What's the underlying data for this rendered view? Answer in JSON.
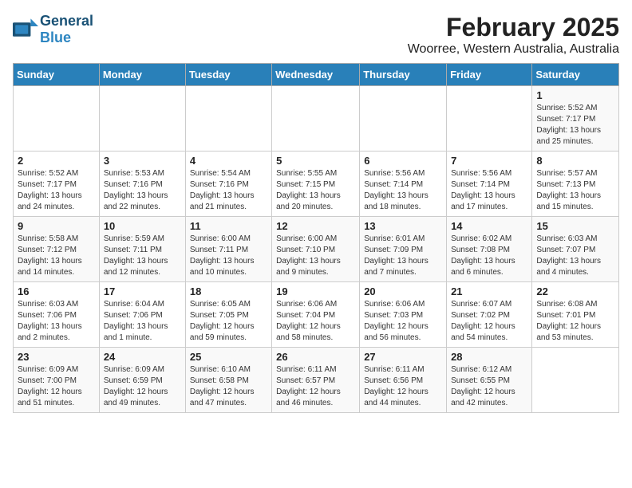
{
  "header": {
    "logo_general": "General",
    "logo_blue": "Blue",
    "title": "February 2025",
    "subtitle": "Woorree, Western Australia, Australia"
  },
  "days_of_week": [
    "Sunday",
    "Monday",
    "Tuesday",
    "Wednesday",
    "Thursday",
    "Friday",
    "Saturday"
  ],
  "weeks": [
    [
      null,
      null,
      null,
      null,
      null,
      null,
      {
        "day": 1,
        "sunrise": "5:52 AM",
        "sunset": "7:17 PM",
        "daylight": "13 hours and 25 minutes."
      }
    ],
    [
      {
        "day": 2,
        "sunrise": "5:52 AM",
        "sunset": "7:17 PM",
        "daylight": "13 hours and 24 minutes."
      },
      {
        "day": 3,
        "sunrise": "5:53 AM",
        "sunset": "7:16 PM",
        "daylight": "13 hours and 22 minutes."
      },
      {
        "day": 4,
        "sunrise": "5:54 AM",
        "sunset": "7:16 PM",
        "daylight": "13 hours and 21 minutes."
      },
      {
        "day": 5,
        "sunrise": "5:55 AM",
        "sunset": "7:15 PM",
        "daylight": "13 hours and 20 minutes."
      },
      {
        "day": 6,
        "sunrise": "5:56 AM",
        "sunset": "7:14 PM",
        "daylight": "13 hours and 18 minutes."
      },
      {
        "day": 7,
        "sunrise": "5:56 AM",
        "sunset": "7:14 PM",
        "daylight": "13 hours and 17 minutes."
      },
      {
        "day": 8,
        "sunrise": "5:57 AM",
        "sunset": "7:13 PM",
        "daylight": "13 hours and 15 minutes."
      }
    ],
    [
      {
        "day": 9,
        "sunrise": "5:58 AM",
        "sunset": "7:12 PM",
        "daylight": "13 hours and 14 minutes."
      },
      {
        "day": 10,
        "sunrise": "5:59 AM",
        "sunset": "7:11 PM",
        "daylight": "13 hours and 12 minutes."
      },
      {
        "day": 11,
        "sunrise": "6:00 AM",
        "sunset": "7:11 PM",
        "daylight": "13 hours and 10 minutes."
      },
      {
        "day": 12,
        "sunrise": "6:00 AM",
        "sunset": "7:10 PM",
        "daylight": "13 hours and 9 minutes."
      },
      {
        "day": 13,
        "sunrise": "6:01 AM",
        "sunset": "7:09 PM",
        "daylight": "13 hours and 7 minutes."
      },
      {
        "day": 14,
        "sunrise": "6:02 AM",
        "sunset": "7:08 PM",
        "daylight": "13 hours and 6 minutes."
      },
      {
        "day": 15,
        "sunrise": "6:03 AM",
        "sunset": "7:07 PM",
        "daylight": "13 hours and 4 minutes."
      }
    ],
    [
      {
        "day": 16,
        "sunrise": "6:03 AM",
        "sunset": "7:06 PM",
        "daylight": "13 hours and 2 minutes."
      },
      {
        "day": 17,
        "sunrise": "6:04 AM",
        "sunset": "7:06 PM",
        "daylight": "13 hours and 1 minute."
      },
      {
        "day": 18,
        "sunrise": "6:05 AM",
        "sunset": "7:05 PM",
        "daylight": "12 hours and 59 minutes."
      },
      {
        "day": 19,
        "sunrise": "6:06 AM",
        "sunset": "7:04 PM",
        "daylight": "12 hours and 58 minutes."
      },
      {
        "day": 20,
        "sunrise": "6:06 AM",
        "sunset": "7:03 PM",
        "daylight": "12 hours and 56 minutes."
      },
      {
        "day": 21,
        "sunrise": "6:07 AM",
        "sunset": "7:02 PM",
        "daylight": "12 hours and 54 minutes."
      },
      {
        "day": 22,
        "sunrise": "6:08 AM",
        "sunset": "7:01 PM",
        "daylight": "12 hours and 53 minutes."
      }
    ],
    [
      {
        "day": 23,
        "sunrise": "6:09 AM",
        "sunset": "7:00 PM",
        "daylight": "12 hours and 51 minutes."
      },
      {
        "day": 24,
        "sunrise": "6:09 AM",
        "sunset": "6:59 PM",
        "daylight": "12 hours and 49 minutes."
      },
      {
        "day": 25,
        "sunrise": "6:10 AM",
        "sunset": "6:58 PM",
        "daylight": "12 hours and 47 minutes."
      },
      {
        "day": 26,
        "sunrise": "6:11 AM",
        "sunset": "6:57 PM",
        "daylight": "12 hours and 46 minutes."
      },
      {
        "day": 27,
        "sunrise": "6:11 AM",
        "sunset": "6:56 PM",
        "daylight": "12 hours and 44 minutes."
      },
      {
        "day": 28,
        "sunrise": "6:12 AM",
        "sunset": "6:55 PM",
        "daylight": "12 hours and 42 minutes."
      },
      null
    ]
  ]
}
